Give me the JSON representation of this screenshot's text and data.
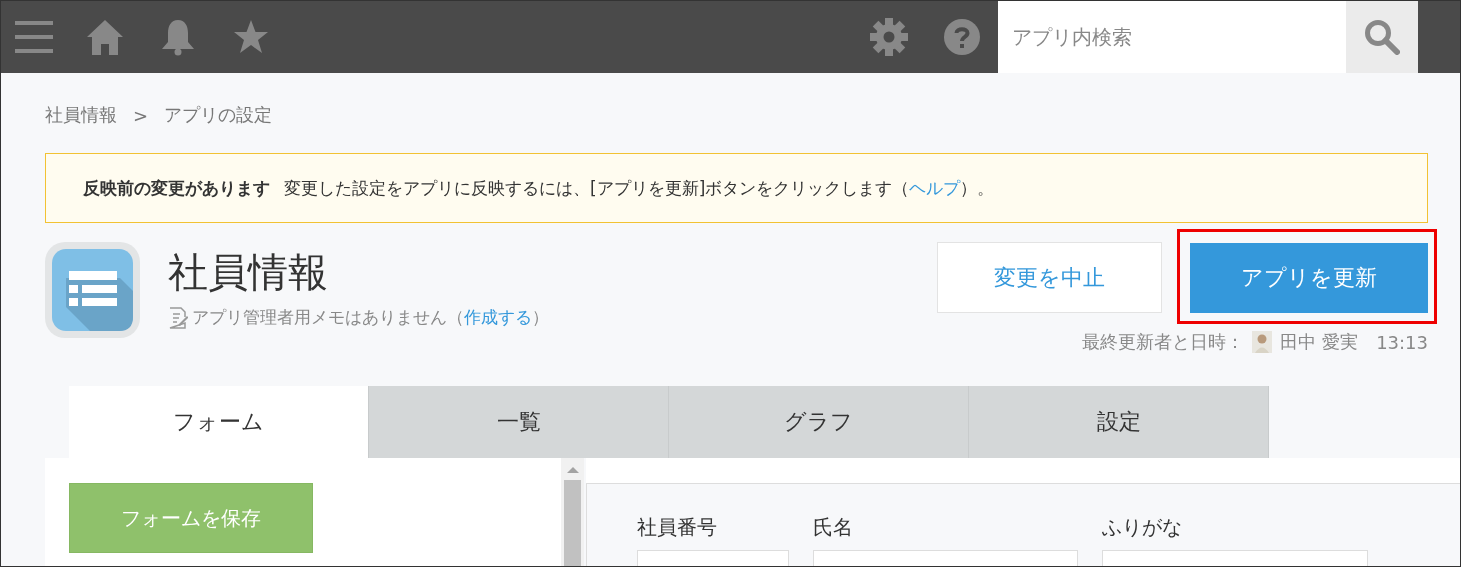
{
  "header": {
    "search": {
      "placeholder": "アプリ内検索"
    }
  },
  "breadcrumb": {
    "items": [
      "社員情報",
      "アプリの設定"
    ],
    "separator": ">"
  },
  "notice": {
    "title": "反映前の変更があります",
    "message": "変更した設定をアプリに反映するには、[アプリを更新]ボタンをクリックします（",
    "link": "ヘルプ",
    "after": "）。"
  },
  "app": {
    "name": "社員情報",
    "memo": {
      "text": "アプリ管理者用メモはありません（",
      "link": "作成する",
      "after": "）"
    }
  },
  "actions": {
    "cancel": "変更を中止",
    "update": "アプリを更新",
    "update_highlighted": true
  },
  "last_updated": {
    "label": "最終更新者と日時：",
    "user": "田中 愛実",
    "time": "13:13"
  },
  "tabs": [
    {
      "label": "フォーム",
      "selected": true
    },
    {
      "label": "一覧",
      "selected": false
    },
    {
      "label": "グラフ",
      "selected": false
    },
    {
      "label": "設定",
      "selected": false
    }
  ],
  "form": {
    "save": "フォームを保存",
    "fields": [
      {
        "label": "社員番号"
      },
      {
        "label": "氏名"
      },
      {
        "label": "ふりがな"
      }
    ]
  }
}
